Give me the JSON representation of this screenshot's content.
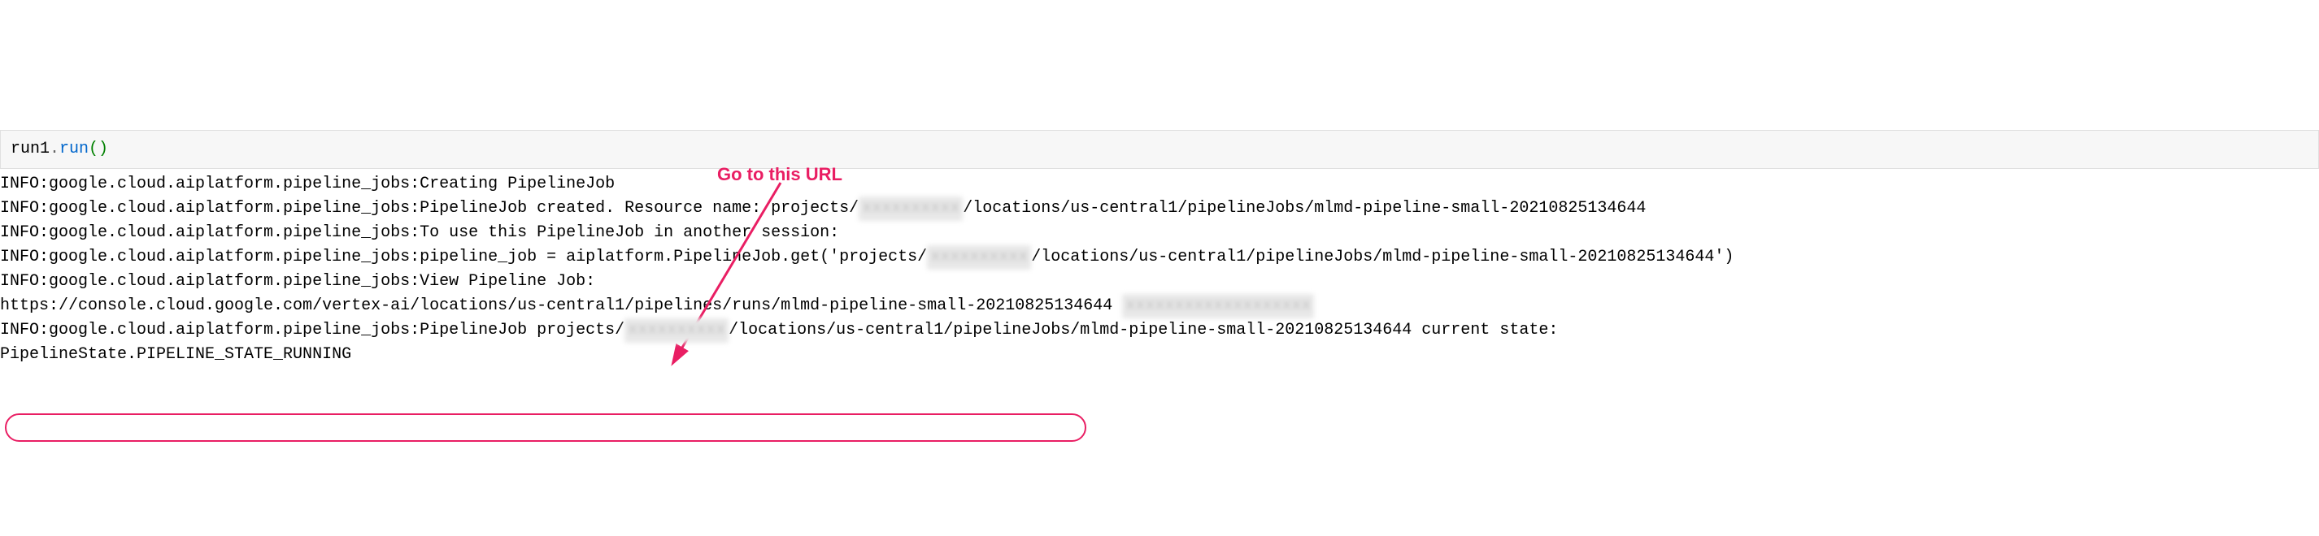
{
  "annotation": {
    "label": "Go to this URL",
    "color": "#e91e63"
  },
  "code_cell": {
    "object": "run1",
    "method": "run",
    "call_suffix": "()"
  },
  "output": {
    "line1_prefix": "INFO:google.cloud.aiplatform.pipeline_jobs:Creating PipelineJob",
    "line2_prefix": "INFO:google.cloud.aiplatform.pipeline_jobs:PipelineJob created. Resource name: projects/",
    "line2_blur": "xxxxxxxxxx",
    "line2_suffix": "/locations/us-central1/pipelineJobs/mlmd-pipeline-small-20210825134644",
    "line3": "INFO:google.cloud.aiplatform.pipeline_jobs:To use this PipelineJob in another session:",
    "line4_prefix": "INFO:google.cloud.aiplatform.pipeline_jobs:pipeline_job = aiplatform.PipelineJob.get('projects/",
    "line4_blur": "xxxxxxxxxx",
    "line4_suffix": "/locations/us-central1/pipelineJobs/mlmd-pipeline-small-20210825134644')",
    "line5": "INFO:google.cloud.aiplatform.pipeline_jobs:View Pipeline Job:",
    "line6_url": "https://console.cloud.google.com/vertex-ai/locations/us-central1/pipelines/runs/mlmd-pipeline-small-20210825134644",
    "line6_blur": "xxxxxxxxxxxxxxxxxxx",
    "line7_prefix": "INFO:google.cloud.aiplatform.pipeline_jobs:PipelineJob projects/",
    "line7_blur": "xxxxxxxxxx",
    "line7_suffix": "/locations/us-central1/pipelineJobs/mlmd-pipeline-small-20210825134644 current state:",
    "line8": "PipelineState.PIPELINE_STATE_RUNNING"
  }
}
